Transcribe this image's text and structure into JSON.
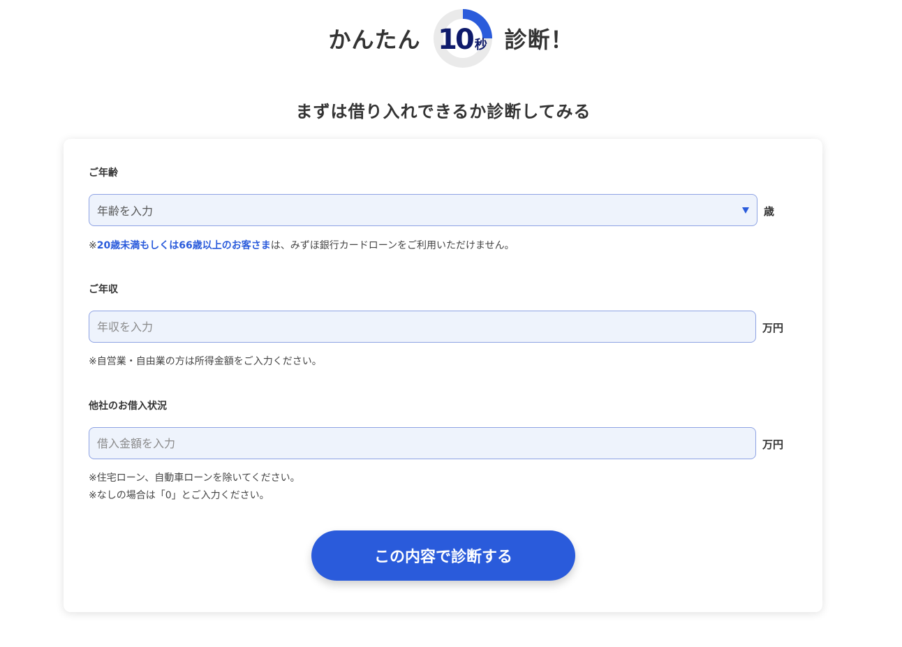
{
  "hero": {
    "text_left": "かんたん",
    "timer_number": "10",
    "timer_unit": "秒",
    "timer_progress": 0.25,
    "text_right": "診断！"
  },
  "subheading": "まずは借り入れできるか診断してみる",
  "colors": {
    "accent": "#2a5bdb",
    "timer_text": "#0e1a6b",
    "timer_ring_bg": "#eaeaea",
    "input_bg": "#eef3fc",
    "input_border": "#8da2e3"
  },
  "form": {
    "age": {
      "label": "ご年齢",
      "placeholder": "年齢を入力",
      "unit": "歳",
      "note_prefix": "※",
      "note_highlight": "20歳未満もしくは66歳以上のお客さま",
      "note_suffix": "は、みずほ銀行カードローンをご利用いただけません。"
    },
    "income": {
      "label": "ご年収",
      "placeholder": "年収を入力",
      "unit": "万円",
      "note": "※自営業・自由業の方は所得金額をご入力ください。"
    },
    "other_loans": {
      "label": "他社のお借入状況",
      "placeholder": "借入金額を入力",
      "unit": "万円",
      "note_line1": "※住宅ローン、自動車ローンを除いてください。",
      "note_line2": "※なしの場合は「0」とご入力ください。"
    },
    "submit_label": "この内容で診断する"
  }
}
